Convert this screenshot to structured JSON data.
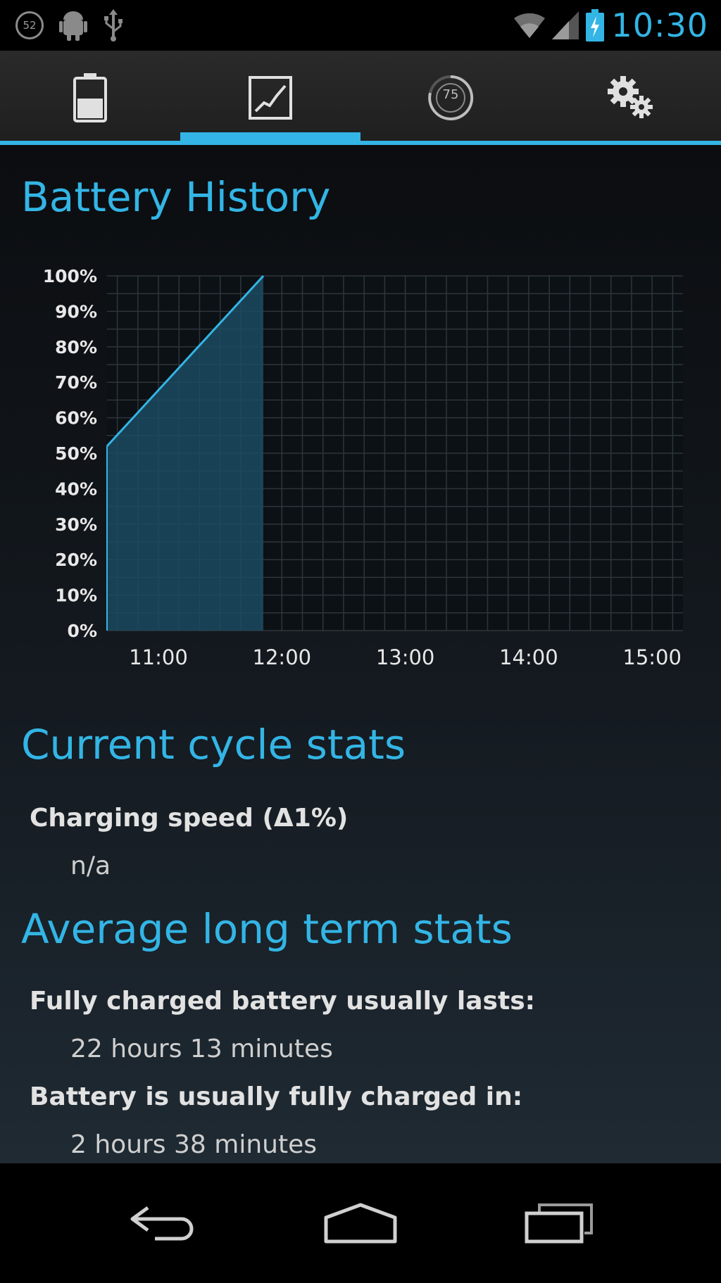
{
  "status_bar": {
    "notification_count": "52",
    "time": "10:30"
  },
  "tabs": [
    {
      "icon": "battery-icon",
      "selected": false
    },
    {
      "icon": "chart-icon",
      "selected": true
    },
    {
      "icon": "timer-75-icon",
      "label": "75",
      "selected": false
    },
    {
      "icon": "settings-icon",
      "selected": false
    }
  ],
  "battery_history": {
    "title": "Battery History"
  },
  "chart_data": {
    "type": "area",
    "title": "",
    "xlabel": "",
    "ylabel": "",
    "x_ticks": [
      "11:00",
      "12:00",
      "13:00",
      "14:00",
      "15:00"
    ],
    "y_ticks": [
      "0%",
      "10%",
      "20%",
      "30%",
      "40%",
      "50%",
      "60%",
      "70%",
      "80%",
      "90%",
      "100%"
    ],
    "ylim": [
      0,
      100
    ],
    "xlim": [
      "10:35",
      "15:15"
    ],
    "grid": true,
    "series": [
      {
        "x": [
          "10:35",
          "11:51",
          "11:51"
        ],
        "y": [
          52,
          100,
          0
        ]
      }
    ],
    "colors": {
      "line": "#33b5e5",
      "fill": "#1c4a60"
    }
  },
  "current_cycle": {
    "title": "Current cycle stats",
    "charging_speed_label": "Charging speed (Δ1%)",
    "charging_speed_value": "n/a"
  },
  "long_term": {
    "title": "Average long term stats",
    "lasts_label": "Fully charged battery usually lasts:",
    "lasts_value": "22 hours 13 minutes",
    "charged_label": "Battery is usually fully charged in:",
    "charged_value": "2 hours 38 minutes"
  },
  "nav_bar": {
    "buttons": [
      "back-icon",
      "home-icon",
      "recent-apps-icon"
    ]
  },
  "colors": {
    "accent": "#33b5e5",
    "background": "#000000"
  }
}
